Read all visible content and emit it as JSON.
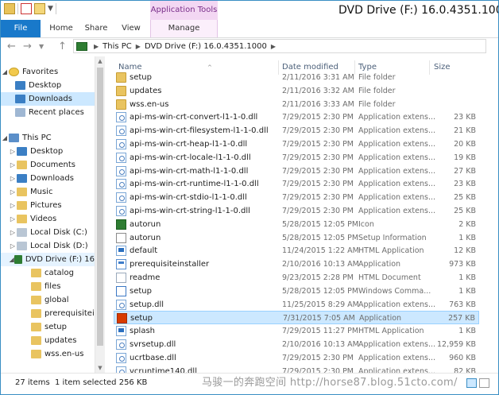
{
  "window": {
    "title": "DVD Drive (F:) 16.0.4351.1000",
    "context_tab_group": "Application Tools"
  },
  "ribbon": {
    "tabs": [
      {
        "label": "File"
      },
      {
        "label": "Home"
      },
      {
        "label": "Share"
      },
      {
        "label": "View"
      },
      {
        "label": "Manage"
      }
    ]
  },
  "address": {
    "crumbs": [
      "This PC",
      "DVD Drive (F:) 16.0.4351.1000"
    ]
  },
  "nav": {
    "favorites_label": "Favorites",
    "favorites": [
      "Desktop",
      "Downloads",
      "Recent places"
    ],
    "thispc_label": "This PC",
    "thispc": [
      "Desktop",
      "Documents",
      "Downloads",
      "Music",
      "Pictures",
      "Videos",
      "Local Disk (C:)",
      "Local Disk (D:)",
      "DVD Drive (F:) 16"
    ],
    "dvd_children": [
      "catalog",
      "files",
      "global",
      "prerequisiteinst",
      "setup",
      "updates",
      "wss.en-us"
    ]
  },
  "columns": {
    "name": "Name",
    "date": "Date modified",
    "type": "Type",
    "size": "Size"
  },
  "files": [
    {
      "name": "setup",
      "date": "2/11/2016 3:31 AM",
      "type": "File folder",
      "size": "",
      "icon": "folder-icon"
    },
    {
      "name": "updates",
      "date": "2/11/2016 3:32 AM",
      "type": "File folder",
      "size": "",
      "icon": "folder-icon"
    },
    {
      "name": "wss.en-us",
      "date": "2/11/2016 3:33 AM",
      "type": "File folder",
      "size": "",
      "icon": "folder-icon"
    },
    {
      "name": "api-ms-win-crt-convert-l1-1-0.dll",
      "date": "7/29/2015 2:30 PM",
      "type": "Application extens...",
      "size": "23 KB",
      "icon": "dll-icon"
    },
    {
      "name": "api-ms-win-crt-filesystem-l1-1-0.dll",
      "date": "7/29/2015 2:30 PM",
      "type": "Application extens...",
      "size": "21 KB",
      "icon": "dll-icon"
    },
    {
      "name": "api-ms-win-crt-heap-l1-1-0.dll",
      "date": "7/29/2015 2:30 PM",
      "type": "Application extens...",
      "size": "20 KB",
      "icon": "dll-icon"
    },
    {
      "name": "api-ms-win-crt-locale-l1-1-0.dll",
      "date": "7/29/2015 2:30 PM",
      "type": "Application extens...",
      "size": "19 KB",
      "icon": "dll-icon"
    },
    {
      "name": "api-ms-win-crt-math-l1-1-0.dll",
      "date": "7/29/2015 2:30 PM",
      "type": "Application extens...",
      "size": "27 KB",
      "icon": "dll-icon"
    },
    {
      "name": "api-ms-win-crt-runtime-l1-1-0.dll",
      "date": "7/29/2015 2:30 PM",
      "type": "Application extens...",
      "size": "23 KB",
      "icon": "dll-icon"
    },
    {
      "name": "api-ms-win-crt-stdio-l1-1-0.dll",
      "date": "7/29/2015 2:30 PM",
      "type": "Application extens...",
      "size": "25 KB",
      "icon": "dll-icon"
    },
    {
      "name": "api-ms-win-crt-string-l1-1-0.dll",
      "date": "7/29/2015 2:30 PM",
      "type": "Application extens...",
      "size": "25 KB",
      "icon": "dll-icon"
    },
    {
      "name": "autorun",
      "date": "5/28/2015 12:05 PM",
      "type": "Icon",
      "size": "2 KB",
      "icon": "autorun-icon"
    },
    {
      "name": "autorun",
      "date": "5/28/2015 12:05 PM",
      "type": "Setup Information",
      "size": "1 KB",
      "icon": "setup-info-icon"
    },
    {
      "name": "default",
      "date": "11/24/2015 1:22 AM",
      "type": "HTML Application",
      "size": "12 KB",
      "icon": "html-app-icon"
    },
    {
      "name": "prerequisiteinstaller",
      "date": "2/10/2016 10:13 AM",
      "type": "Application",
      "size": "973 KB",
      "icon": "app-icon"
    },
    {
      "name": "readme",
      "date": "9/23/2015 2:28 PM",
      "type": "HTML Document",
      "size": "1 KB",
      "icon": "html-doc-icon"
    },
    {
      "name": "setup",
      "date": "5/28/2015 12:05 PM",
      "type": "Windows Comma...",
      "size": "1 KB",
      "icon": "cmd-icon"
    },
    {
      "name": "setup.dll",
      "date": "11/25/2015 8:29 AM",
      "type": "Application extens...",
      "size": "763 KB",
      "icon": "dll-icon"
    },
    {
      "name": "setup",
      "date": "7/31/2015 7:05 AM",
      "type": "Application",
      "size": "257 KB",
      "icon": "office-setup-icon",
      "selected": true
    },
    {
      "name": "splash",
      "date": "7/29/2015 11:27 PM",
      "type": "HTML Application",
      "size": "1 KB",
      "icon": "html-app-icon"
    },
    {
      "name": "svrsetup.dll",
      "date": "2/10/2016 10:13 AM",
      "type": "Application extens...",
      "size": "12,959 KB",
      "icon": "dll-icon"
    },
    {
      "name": "ucrtbase.dll",
      "date": "7/29/2015 2:30 PM",
      "type": "Application extens...",
      "size": "960 KB",
      "icon": "dll-icon"
    },
    {
      "name": "vcruntime140.dll",
      "date": "7/29/2015 2:30 PM",
      "type": "Application extens...",
      "size": "82 KB",
      "icon": "dll-icon"
    }
  ],
  "status": {
    "item_count": "27 items",
    "selection": "1 item selected  256 KB"
  },
  "watermark": "马骏一的奔跑空间 http://horse87.blog.51cto.com/"
}
